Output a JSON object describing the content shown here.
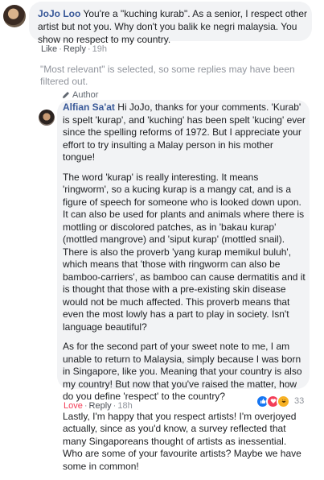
{
  "comment": {
    "author": "JoJo Loo",
    "text": "You're a \"kuching kurab\". As a senior, I respect other artist but not you. Why don't you balik ke negri malaysia. You show no respect to my country.",
    "actions": {
      "like": "Like",
      "reply": "Reply",
      "time": "19h"
    }
  },
  "notice": "\"Most relevant\" is selected, so some replies may have been filtered out.",
  "reply": {
    "badge": "Author",
    "author": "Alfian Sa'at",
    "first_text": "Hi JoJo, thanks for your comments. 'Kurab' is spelt 'kurap', and 'kuching' has been spelt 'kucing' ever since the spelling reforms of 1972. But I appreciate your effort to try insulting a Malay person in his mother tongue!",
    "paragraphs": [
      "The word 'kurap' is really interesting. It means 'ringworm', so a kucing kurap is a mangy cat, and is a figure of speech for someone who is looked down upon. It can also be used for plants and animals where there is mottling or discolored patches, as in 'bakau kurap' (mottled mangrove) and 'siput kurap' (mottled snail). There is also the proverb 'yang kurap memikul buluh', which means that 'those with ringworm can also be bamboo-carriers', as bamboo can cause dermatitis and it is thought that those with a pre-existing skin disease would not be much affected. This proverb means that even the most lowly has a part to play in society. Isn't language beautiful?",
      "As for the second part of your sweet note to me, I am unable to return to Malaysia, simply because I was born in Singapore, like you. Meaning that your country is also my country! But now that you've raised the matter, how do you define 'respect' to the country?",
      "Lastly, I'm happy that you respect artists! I'm overjoyed actually, since as you'd know, a survey reflected that many Singaporeans thought of artists as inessential. Who are some of your favourite artists? Maybe we have some in common!"
    ],
    "actions": {
      "love": "Love",
      "reply": "Reply",
      "time": "18h"
    },
    "reactions": {
      "count": "33",
      "icons": [
        "like-icon",
        "love-icon",
        "haha-icon"
      ]
    }
  }
}
